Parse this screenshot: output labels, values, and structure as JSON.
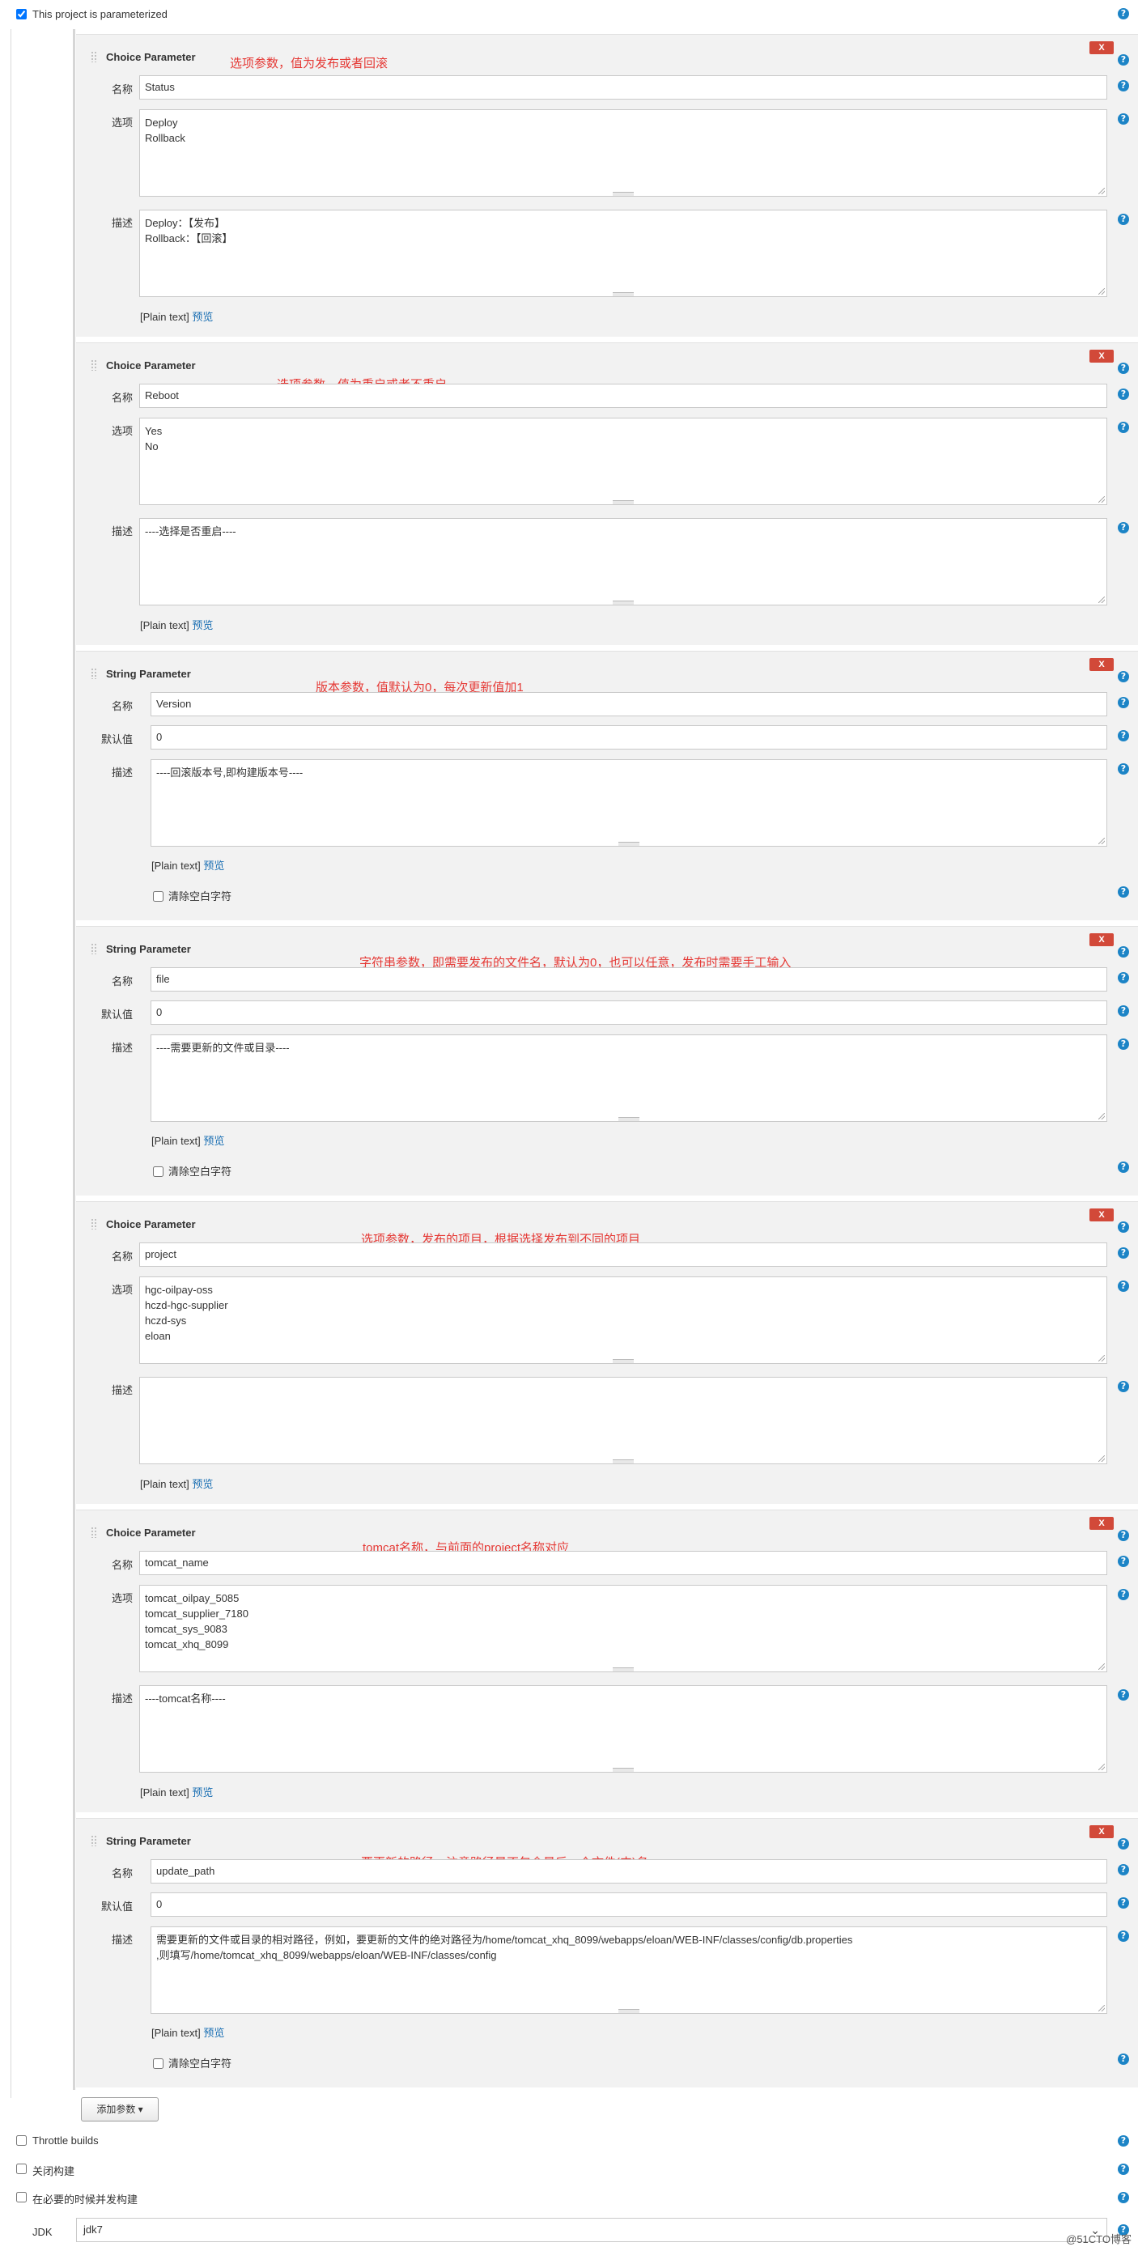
{
  "header": {
    "parameterized_label": "This project is parameterized",
    "help": "?"
  },
  "common": {
    "delete": "X",
    "name_label": "名称",
    "choices_label": "选项",
    "default_label": "默认值",
    "desc_label": "描述",
    "plain_text": "[Plain text]",
    "preview": "预览",
    "trim_label": "清除空白字符"
  },
  "params": [
    {
      "type": "Choice Parameter",
      "annotation": "选项参数，值为发布或者回滚",
      "name": "Status",
      "choices": "Deploy\nRollback",
      "description": "Deploy：【发布】\nRollback：【回滚】"
    },
    {
      "type": "Choice Parameter",
      "annotation": "选项参数，值为重启或者不重启",
      "name": "Reboot",
      "choices": "Yes\nNo",
      "description": "----选择是否重启----"
    },
    {
      "type": "String Parameter",
      "annotation": "版本参数，值默认为0，每次更新值加1",
      "name": "Version",
      "default": "0",
      "description": "----回滚版本号,即构建版本号----"
    },
    {
      "type": "String Parameter",
      "annotation": "字符串参数，即需要发布的文件名，默认为0，也可以任意，发布时需要手工输入",
      "name": "file",
      "default": "0",
      "description": "----需要更新的文件或目录----"
    },
    {
      "type": "Choice Parameter",
      "annotation": "选项参数，发布的项目，根据选择发布到不同的项目",
      "name": "project",
      "choices": "hgc-oilpay-oss\nhczd-hgc-supplier\nhczd-sys\neloan",
      "description": ""
    },
    {
      "type": "Choice Parameter",
      "annotation": "tomcat名称，与前面的project名称对应",
      "name": "tomcat_name",
      "choices": "tomcat_oilpay_5085\ntomcat_supplier_7180\ntomcat_sys_9083\ntomcat_xhq_8099",
      "description": "----tomcat名称----"
    },
    {
      "type": "String Parameter",
      "annotation": "要更新的路径，注意路径是不包含最后一个文件(夹)名",
      "name": "update_path",
      "default": "0",
      "description": "需要更新的文件或目录的相对路径，例如，要更新的文件的绝对路径为/home/tomcat_xhq_8099/webapps/eloan/WEB-INF/classes/config/db.properties\n,则填写/home/tomcat_xhq_8099/webapps/eloan/WEB-INF/classes/config"
    }
  ],
  "add_param_button": "添加参数 ▾",
  "options": [
    "Throttle builds",
    "关闭构建",
    "在必要的时候并发构建"
  ],
  "jdk": {
    "label": "JDK",
    "value": "jdk7"
  },
  "watermark": "@51CTO博客"
}
